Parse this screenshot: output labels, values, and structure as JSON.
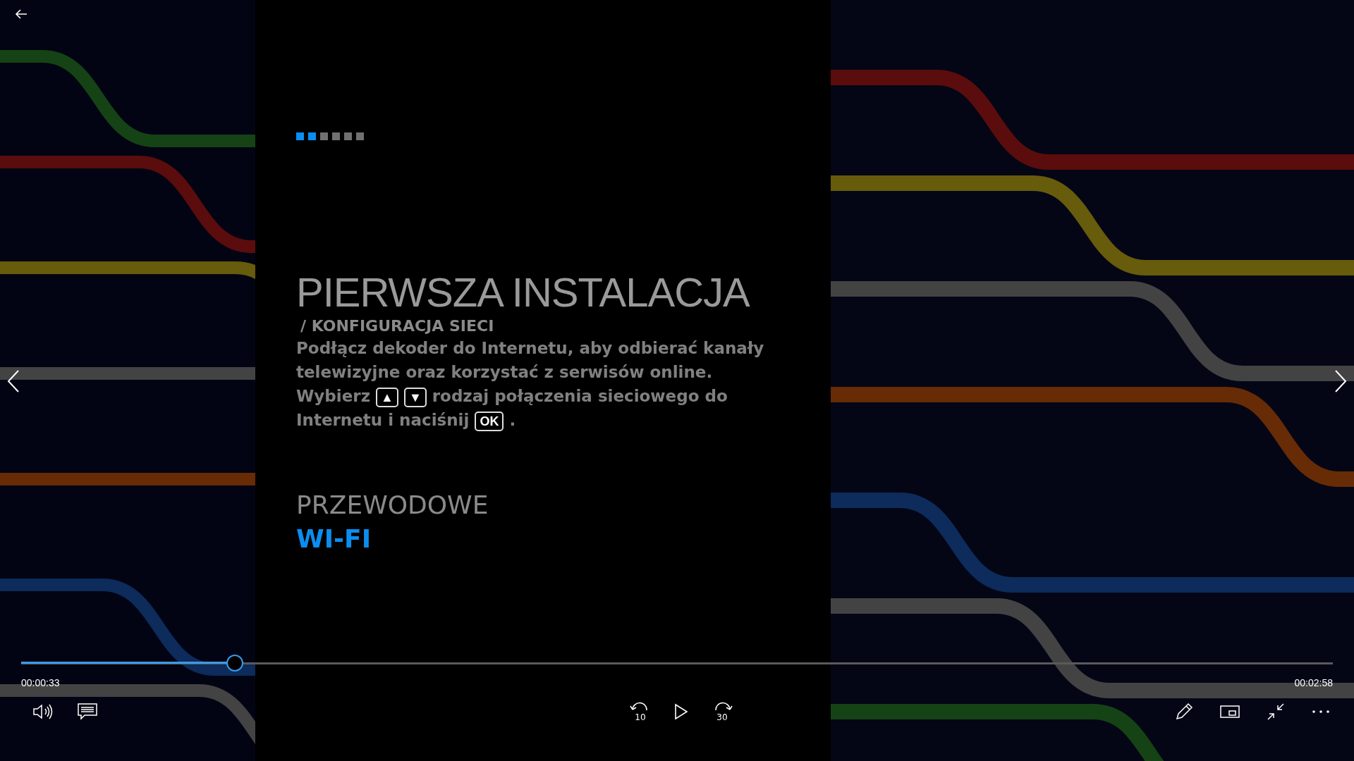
{
  "screen": {
    "steps": [
      {
        "selected": true
      },
      {
        "selected": true
      },
      {
        "selected": false
      },
      {
        "selected": false
      },
      {
        "selected": false
      },
      {
        "selected": false
      }
    ],
    "title": "PIERWSZA INSTALACJA",
    "subtitle": "/ KONFIGURACJA SIECI",
    "paragraph": [
      {
        "kind": "text",
        "text": "Podłącz dekoder do Internetu, aby odbierać kanały telewizyjne oraz korzystać z serwisów online. Wybierz"
      },
      {
        "kind": "key",
        "text": "▲"
      },
      {
        "kind": "key",
        "text": "▼"
      },
      {
        "kind": "text",
        "text": "rodzaj połączenia sieciowego do Internetu i naciśnij"
      },
      {
        "kind": "key",
        "text": "OK"
      },
      {
        "kind": "text",
        "text": "."
      }
    ],
    "options": [
      {
        "label": "PRZEWODOWE",
        "selected": false
      },
      {
        "label": "WI-FI",
        "selected": true
      }
    ]
  },
  "player": {
    "progress": {
      "level": 0.163
    },
    "elapsed": "00:00:33",
    "duration": "00:02:58",
    "skip_back": "10",
    "skip_forward": "30"
  }
}
